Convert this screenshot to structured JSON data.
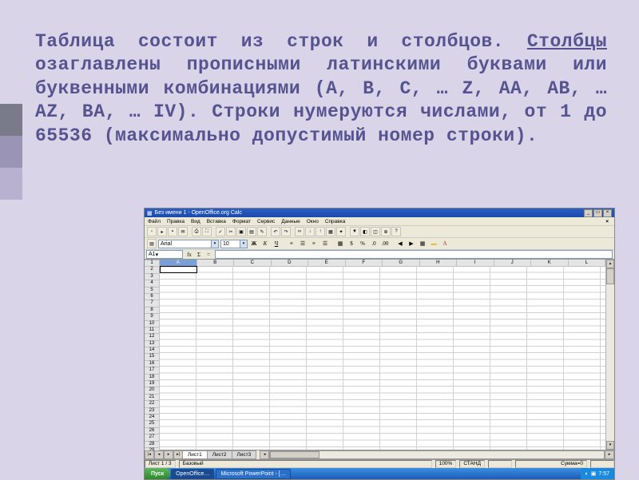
{
  "sidebar_colors": [
    "#7a7a8a",
    "#9a95b5",
    "#b8b2d0"
  ],
  "text": {
    "line1": "Таблица состоит из строк и столбцов.",
    "word_columns": "Столбцы",
    "line2_rest": " озаглавлены прописными латинскими буквами или буквенными комбинациями (A, B, C, … Z, AA, AB, … AZ, BA, … IV).",
    "line3": "Строки нумеруются числами, от 1 до 65536 (максимально допустимый номер строки)."
  },
  "app": {
    "title": "Без имени 1 - OpenOffice.org Calc",
    "menus": [
      "Файл",
      "Правка",
      "Вид",
      "Вставка",
      "Формат",
      "Сервис",
      "Данные",
      "Окно",
      "Справка"
    ],
    "font_name": "Arial",
    "font_size": "10",
    "bold": "Ж",
    "italic": "К",
    "underline": "Ч",
    "cell_ref": "A1",
    "columns": [
      "A",
      "B",
      "C",
      "D",
      "E",
      "F",
      "G",
      "H",
      "I",
      "J",
      "K",
      "L"
    ],
    "row_count": 29,
    "sheets": [
      "Лист1",
      "Лист2",
      "Лист3"
    ],
    "status": {
      "sheet": "Лист 1 / 3",
      "style": "Базовый",
      "mode": "СТАНД",
      "sum": "Сумма=0",
      "zoom": "100%"
    },
    "taskbar": {
      "start": "Пуск",
      "items": [
        "OpenOffice…",
        "Microsoft PowerPoint - […"
      ],
      "time": "7:57"
    }
  }
}
